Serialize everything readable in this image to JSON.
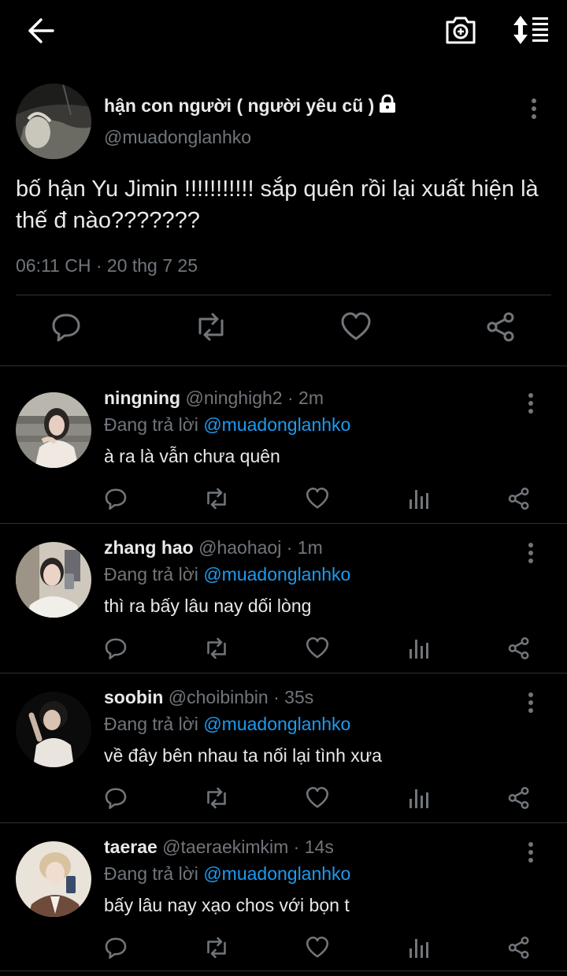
{
  "header": {
    "back_icon": "arrow-left-icon",
    "camera_icon": "camera-plus-icon",
    "sort_icon": "sort-lines-icon"
  },
  "tweet": {
    "author_name": "hận con người ( người yêu cũ )",
    "author_handle": "@muadonglanhko",
    "protected_icon": "lock-icon",
    "text": "bố hận Yu Jimin !!!!!!!!!!! sắp quên rồi lại xuất hiện là thế đ nào???????",
    "meta": "06:11 CH · 20 thg 7 25"
  },
  "replies": [
    {
      "name": "ningning",
      "handle": "@ninghigh2",
      "dot": "·",
      "time": "2m",
      "replying_prefix": "Đang trả lời",
      "replying_to": "@muadonglanhko",
      "text": "à ra là vẫn chưa quên"
    },
    {
      "name": "zhang hao",
      "handle": "@haohaoj",
      "dot": "·",
      "time": "1m",
      "replying_prefix": "Đang trả lời",
      "replying_to": "@muadonglanhko",
      "text": "thì ra bấy lâu nay dối lòng"
    },
    {
      "name": "soobin",
      "handle": "@choibinbin",
      "dot": "·",
      "time": "35s",
      "replying_prefix": "Đang trả lời",
      "replying_to": "@muadonglanhko",
      "text": "về đây bên nhau ta nối lại tình xưa"
    },
    {
      "name": "taerae",
      "handle": "@taeraekimkim",
      "dot": "·",
      "time": "14s",
      "replying_prefix": "Đang trả lời",
      "replying_to": "@muadonglanhko",
      "text": "bấy lâu nay xạo chos với bọn t"
    }
  ],
  "colors": {
    "background": "#000000",
    "text": "#e7e9ea",
    "muted": "#71767b",
    "link": "#1d9bf0",
    "divider": "#2f3336"
  }
}
